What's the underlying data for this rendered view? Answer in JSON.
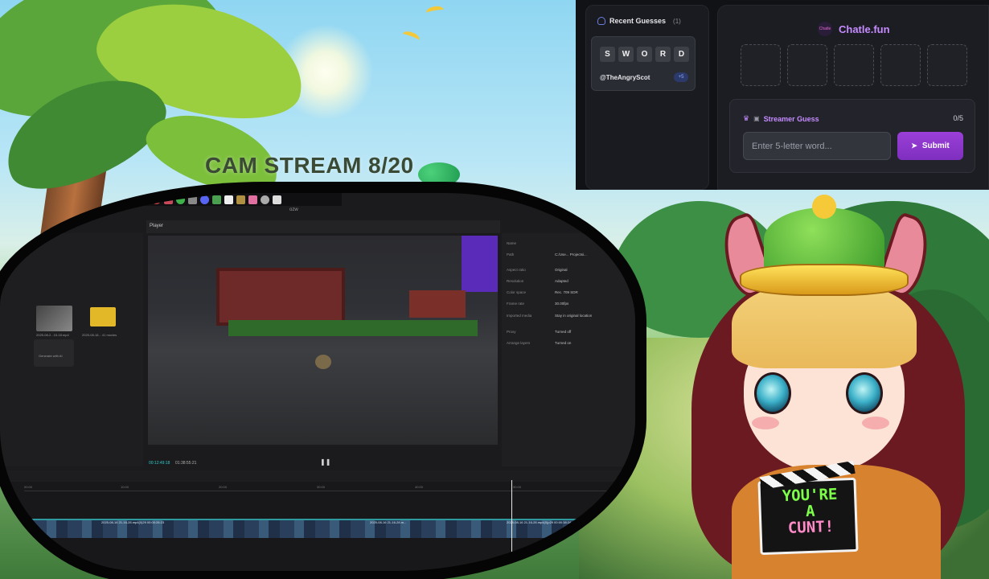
{
  "stream": {
    "title": "CAM STREAM 8/20"
  },
  "editor": {
    "app_title": "ozw",
    "player_label": "Player",
    "media_captions": [
      "2025-08-2...15-18.mp4",
      "2025-08-18... 41 movies"
    ],
    "add_tile_label": "Generate with AI",
    "timecode_current": "00:12:49:18",
    "timecode_total": "01:38:55:21",
    "properties": [
      {
        "label": "Name",
        "value": ""
      },
      {
        "label": "Path",
        "value": "C:/Use... Projectsi..."
      },
      {
        "label": "Aspect ratio",
        "value": "Original"
      },
      {
        "label": "Resolution",
        "value": "Adapted"
      },
      {
        "label": "Color space",
        "value": "Rec. 709 SDR"
      },
      {
        "label": "Frame rate",
        "value": "30.00fps"
      },
      {
        "label": "Imported media",
        "value": "Stay in original location"
      },
      {
        "label": "Proxy",
        "value": "Turned off"
      },
      {
        "label": "Arrange layers",
        "value": "Turned on"
      }
    ],
    "ruler_ticks": [
      "00:00",
      "10:00",
      "20:00",
      "30:00",
      "40:00",
      "50:00"
    ],
    "clip_labels": [
      "2025-08-16 21-16-28.mp4(0)29  00:00:28:23",
      "2025-08-16 21-16-28.m...",
      "2025-08-16 21-16-28.mp4(0)p29  00:00:38:24"
    ]
  },
  "chatle": {
    "recent_guesses": {
      "title": "Recent Guesses",
      "count": "(1)",
      "guesses": [
        {
          "letters": [
            "S",
            "W",
            "O",
            "R",
            "D"
          ],
          "user": "@TheAngryScot",
          "points": "+5"
        }
      ]
    },
    "brand": {
      "logo_text": "Chatle",
      "name": "Chatle.fun"
    },
    "streamer_guess": {
      "title": "Streamer Guess",
      "count": "0/5",
      "input_placeholder": "Enter 5-letter word...",
      "submit_label": "Submit"
    }
  },
  "avatar": {
    "sign_lines": [
      "YOU'RE",
      "A",
      "CUNT!"
    ]
  },
  "colors": {
    "accent_purple": "#9b3fd8",
    "brand_text": "#c58bff",
    "timecode_teal": "#2ec8c8",
    "sign_green": "#7dff4a"
  }
}
